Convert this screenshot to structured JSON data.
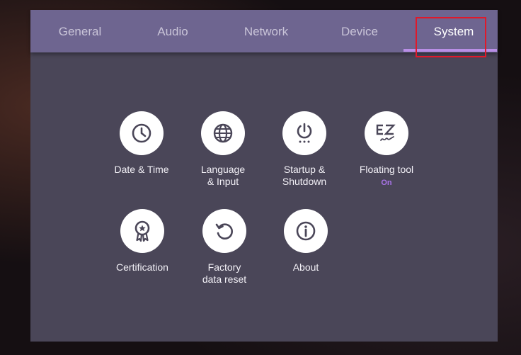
{
  "tabs": [
    {
      "label": "General",
      "active": false
    },
    {
      "label": "Audio",
      "active": false
    },
    {
      "label": "Network",
      "active": false
    },
    {
      "label": "Device",
      "active": false
    },
    {
      "label": "System",
      "active": true
    }
  ],
  "items": [
    {
      "label": "Date & Time",
      "icon": "clock-icon"
    },
    {
      "label": "Language\n& Input",
      "icon": "globe-icon"
    },
    {
      "label": "Startup &\nShutdown",
      "icon": "power-icon"
    },
    {
      "label": "Floating tool",
      "icon": "ez-write-icon",
      "status": "On"
    },
    {
      "label": "Certification",
      "icon": "award-ribbon-icon"
    },
    {
      "label": "Factory\ndata reset",
      "icon": "reset-icon"
    },
    {
      "label": "About",
      "icon": "info-icon"
    }
  ],
  "colors": {
    "tab_bar": "#6e6590",
    "panel": "#4a4658",
    "accent": "#b98ee6",
    "status_on": "#a974e8",
    "highlight": "#e0192a"
  }
}
